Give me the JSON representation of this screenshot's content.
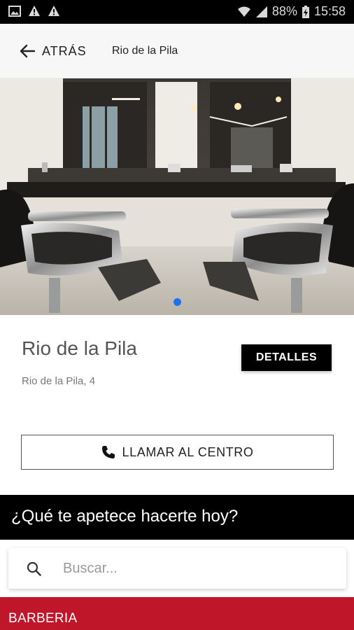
{
  "status_bar": {
    "battery": "88%",
    "time": "15:58",
    "icons": [
      "image-icon",
      "warning-icon",
      "warning-icon",
      "wifi-icon",
      "signal-icon",
      "battery-charging-icon"
    ]
  },
  "header": {
    "back_label": "ATRÁS",
    "title": "Rio de la Pila"
  },
  "hero": {
    "image_description": "barbershop-interior-photo",
    "carousel_dot_color": "#1e73e8"
  },
  "store": {
    "name": "Rio de la Pila",
    "address": "Rio de la Pila, 4",
    "details_label": "DETALLES",
    "call_label": "LLAMAR AL CENTRO"
  },
  "prompt": {
    "question": "¿Qué te apetece hacerte hoy?"
  },
  "search": {
    "placeholder": "Buscar..."
  },
  "category": {
    "label": "BARBERIA",
    "color": "#c0162a"
  }
}
